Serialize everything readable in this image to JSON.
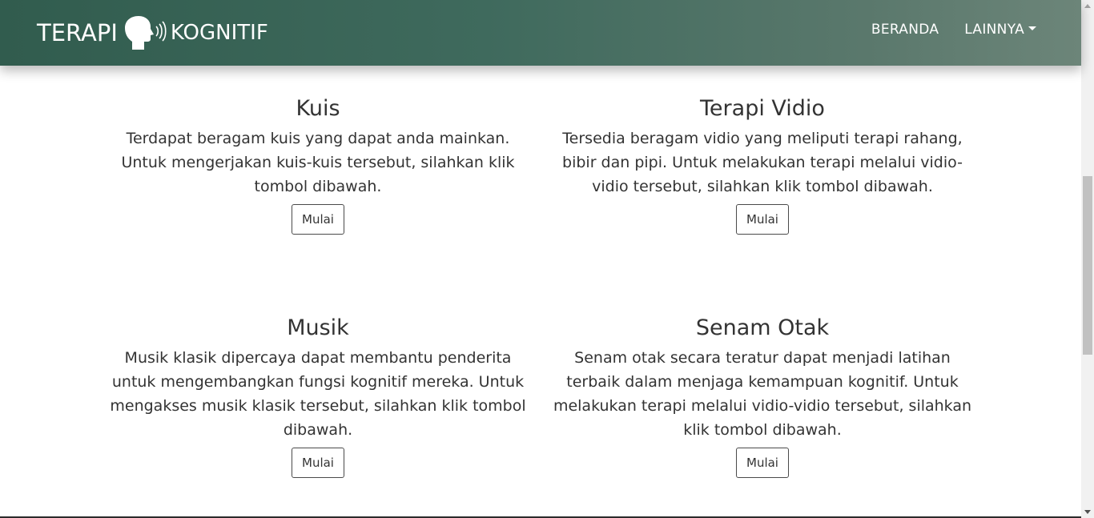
{
  "navbar": {
    "brand_word1": "TERAPI",
    "brand_word2": "KOGNITIF",
    "brand_icon": "head-speaking-icon",
    "links": [
      {
        "label": "BERANDA"
      },
      {
        "label": "LAINNYA",
        "has_dropdown": true
      }
    ],
    "gradient_colors": [
      "#315c4e",
      "#6c8579"
    ]
  },
  "cards": [
    {
      "title": "Kuis",
      "description": "Terdapat beragam kuis yang dapat anda mainkan. Untuk mengerjakan kuis-kuis tersebut, silahkan klik tombol dibawah.",
      "button": "Mulai"
    },
    {
      "title": "Terapi Vidio",
      "description": "Tersedia beragam vidio yang meliputi terapi rahang, bibir dan pipi. Untuk melakukan terapi melalui vidio-vidio tersebut, silahkan klik tombol dibawah.",
      "button": "Mulai"
    },
    {
      "title": "Musik",
      "description": "Musik klasik dipercaya dapat membantu penderita untuk mengembangkan fungsi kognitif mereka. Untuk mengakses musik klasik tersebut, silahkan klik tombol dibawah.",
      "button": "Mulai"
    },
    {
      "title": "Senam Otak",
      "description": "Senam otak secara teratur dapat menjadi latihan terbaik dalam menjaga kemampuan kognitif. Untuk melakukan terapi melalui vidio-vidio tersebut, silahkan klik tombol dibawah.",
      "button": "Mulai"
    }
  ]
}
